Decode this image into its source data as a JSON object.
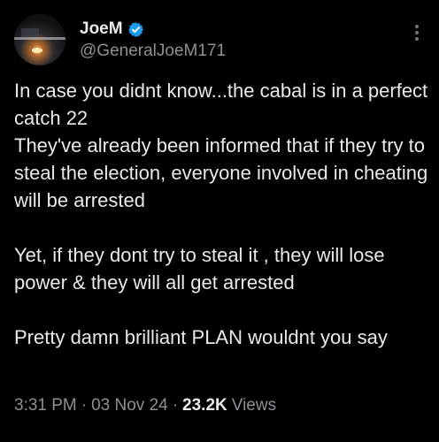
{
  "author": {
    "display_name": "JoeM",
    "handle": "@GeneralJoeM171",
    "verified_color": "#1d9bf0"
  },
  "tweet": {
    "paragraphs": [
      "In case you didnt know...the cabal is in a perfect catch 22\nThey've already been informed that if they try to steal the election, everyone involved in cheating will be arrested",
      "Yet, if they dont try to steal it , they will lose power & they will all get arrested",
      "Pretty damn brilliant PLAN wouldnt you say"
    ]
  },
  "meta": {
    "time": "3:31 PM",
    "separator": "·",
    "date": "03 Nov 24",
    "views_count": "23.2K",
    "views_label": "Views"
  },
  "icons": {
    "verified": "verified-badge-icon",
    "more": "more-options-icon"
  }
}
